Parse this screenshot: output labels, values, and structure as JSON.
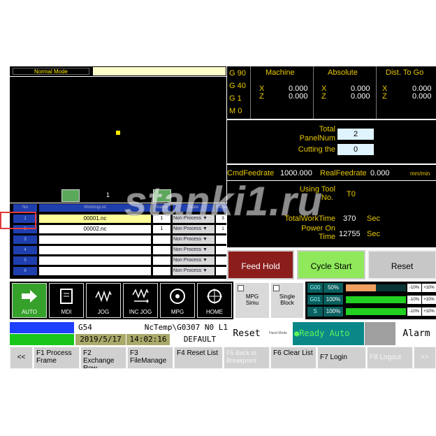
{
  "mode_bar": {
    "mode_label": "Normal Mode"
  },
  "toolstrip": {
    "page_num": "1"
  },
  "program_table": {
    "headers": {
      "no": "No",
      "working_list": "WorkingList",
      "station": "Station",
      "state": "State",
      "repeat": "Repeat"
    },
    "rows": [
      {
        "no": "1",
        "file": "00001.nc",
        "station": "1",
        "state": "Non Process ▼",
        "repeat": "3"
      },
      {
        "no": "2",
        "file": "00002.nc",
        "station": "1",
        "state": "Non Process ▼",
        "repeat": "1"
      },
      {
        "no": "3",
        "file": "",
        "station": "",
        "state": "Non Process ▼",
        "repeat": ""
      },
      {
        "no": "4",
        "file": "",
        "station": "",
        "state": "Non Process ▼",
        "repeat": ""
      },
      {
        "no": "5",
        "file": "",
        "station": "",
        "state": "Non Process ▼",
        "repeat": ""
      },
      {
        "no": "6",
        "file": "",
        "station": "",
        "state": "Non Process ▼",
        "repeat": ""
      }
    ]
  },
  "gcodes": [
    "G 90",
    "G 40",
    "G 1",
    "M 0"
  ],
  "coords": {
    "machine_label": "Machine",
    "absolute_label": "Absolute",
    "dist_label": "Dist. To Go",
    "axis_x": "X",
    "axis_z": "Z",
    "machine_x": "0.000",
    "machine_z": "0.000",
    "absolute_x": "0.000",
    "absolute_z": "0.000",
    "dist_x": "0.000",
    "dist_z": "0.000"
  },
  "panel_counts": {
    "total_label": "Total",
    "panelnum_label": "PanelNum",
    "panelnum_value": "2",
    "cutting_label": "Cutting the",
    "cutting_value": "0"
  },
  "feed": {
    "cmd_label": "CmdFeedrate",
    "cmd_value": "1000.000",
    "real_label": "RealFeedrate",
    "real_value": "0.000",
    "unit": "mm/min"
  },
  "tool": {
    "label_1": "Using Tool",
    "label_2": "No.",
    "value": "T0"
  },
  "work_time": {
    "total_label": "TotalWorkTime",
    "total_value": "370",
    "total_unit": "Sec",
    "power_label_1": "Power On",
    "power_label_2": "Time",
    "power_value": "12755",
    "power_unit": "Sec"
  },
  "command_buttons": {
    "feed_hold": "Feed Hold",
    "cycle_start": "Cycle Start",
    "reset": "Reset"
  },
  "mode_buttons": [
    {
      "label": "AUTO",
      "icon": "arrow-right-icon"
    },
    {
      "label": "MDI",
      "icon": "document-icon"
    },
    {
      "label": "JOG",
      "icon": "wave-icon"
    },
    {
      "label": "INC JOG",
      "icon": "wave-arrow-icon"
    },
    {
      "label": "MPG",
      "icon": "handwheel-icon"
    },
    {
      "label": "HOME",
      "icon": "crosshair-icon"
    }
  ],
  "toggles": {
    "mpg_line1": "MPG",
    "mpg_line2": "Simu",
    "single_line1": "Single",
    "single_line2": "Block"
  },
  "overrides": [
    {
      "tag": "G00",
      "pct": "50%",
      "level": 0.5,
      "color": "#f0a060"
    },
    {
      "tag": "G01",
      "pct": "100%",
      "level": 1.0,
      "color": "#21d021"
    },
    {
      "tag": "S",
      "pct": "100%",
      "level": 1.0,
      "color": "#21d021"
    }
  ],
  "override_steps": {
    "minus": "-10%",
    "plus": "+10%"
  },
  "status": {
    "wcs": "G54",
    "path": "NcTemp\\G0307 N0 L1",
    "date": "2019/5/17",
    "time": "14:02:16",
    "profile": "DEFAULT",
    "reset": "Reset",
    "hand_label": "Hand Mode Frame",
    "ready": "●Ready  Auto",
    "alarm": "Alarm"
  },
  "fkeys": [
    {
      "label": "<<",
      "enabled": true
    },
    {
      "label": "F1 Process Frame",
      "enabled": true
    },
    {
      "label": "F2 Exchange Row",
      "enabled": true
    },
    {
      "label": "F3 FileManage",
      "enabled": true
    },
    {
      "label": "F4 Reset List",
      "enabled": true
    },
    {
      "label": "F5 Back to Breakpoint",
      "enabled": false
    },
    {
      "label": "F6 Clear List",
      "enabled": true
    },
    {
      "label": "F7 Login",
      "enabled": true
    },
    {
      "label": "F8 Logout",
      "enabled": false
    },
    {
      "label": ">>",
      "enabled": false
    }
  ],
  "colors": {
    "auto_active": "#35a12a",
    "feed_hold": "#8b1d1d",
    "cycle_start": "#8fe95b",
    "ready_bg": "#0a8888",
    "highlight_box": "#e23b3b"
  },
  "watermark": "stanki1.ru"
}
